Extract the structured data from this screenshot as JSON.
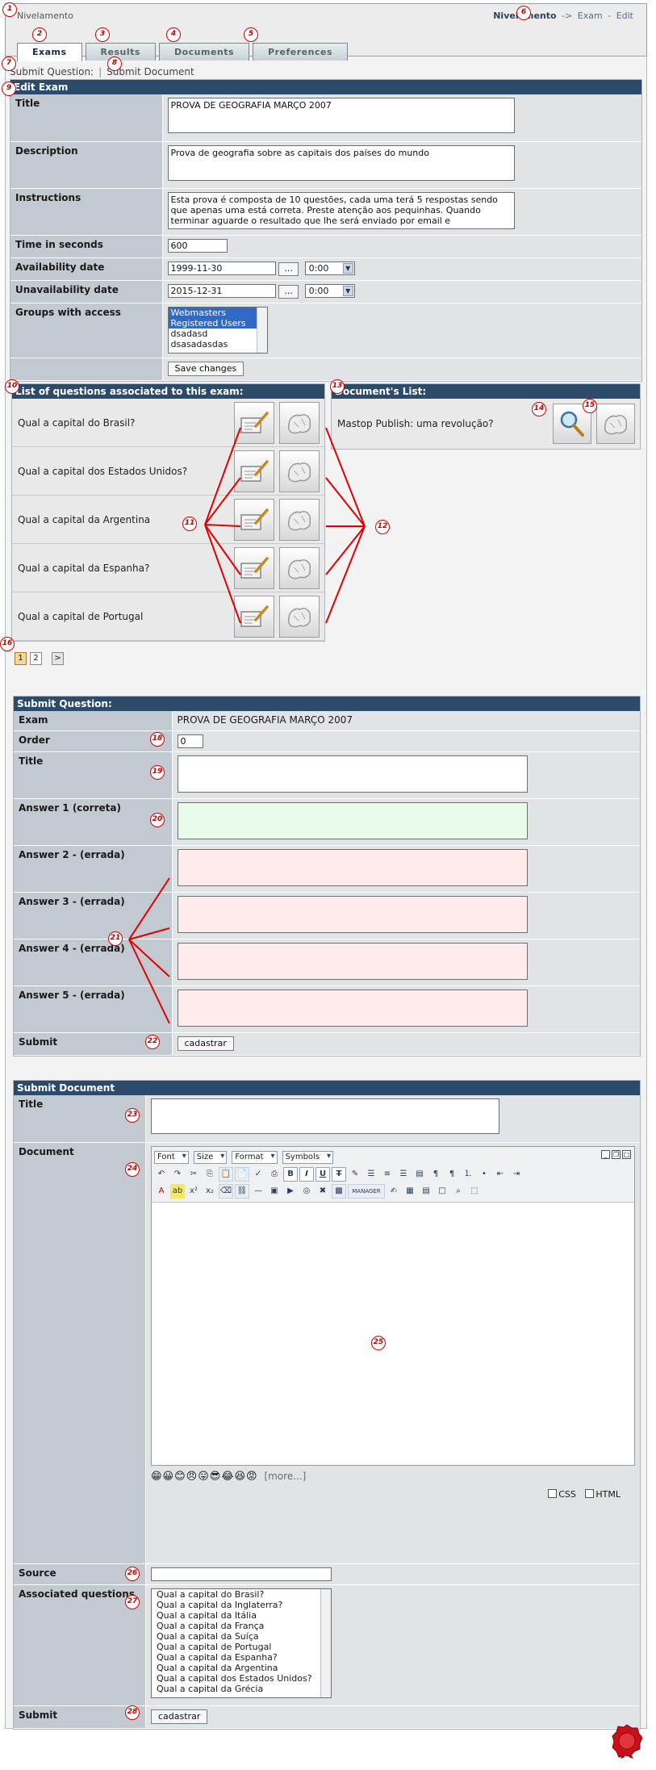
{
  "header": {
    "site_title": "Nivelamento",
    "breadcrumb_root": "Nivelamento",
    "breadcrumb_arrow": "->",
    "breadcrumb_exam": "Exam",
    "breadcrumb_sep": "-",
    "breadcrumb_edit": "Edit"
  },
  "tabs": [
    {
      "label": "Exams"
    },
    {
      "label": "Results"
    },
    {
      "label": "Documents"
    },
    {
      "label": "Preferences"
    }
  ],
  "subnav": {
    "submit_question": "Submit Question:",
    "separator": "|",
    "submit_document": "Submit Document"
  },
  "edit_exam": {
    "heading": "Edit Exam",
    "title_label": "Title",
    "title_value": "PROVA DE GEOGRAFIA MARÇO 2007",
    "description_label": "Description",
    "description_value": "Prova de geografia sobre as capitais dos países do mundo",
    "instructions_label": "Instructions",
    "instructions_value": "Esta prova é composta de 10 questões, cada uma terá 5 respostas sendo que apenas uma está correta. Preste atenção aos pequinhas. Quando terminar aguarde o resultado que lhe será enviado por email e",
    "time_label": "Time in seconds",
    "time_value": "600",
    "availability_label": "Availability date",
    "availability_date": "1999-11-30",
    "availability_time": "0:00",
    "unavailability_label": "Unavailability date",
    "unavailability_date": "2015-12-31",
    "unavailability_time": "0:00",
    "date_button": "...",
    "groups_label": "Groups with access",
    "groups": [
      "Webmasters",
      "Registered Users",
      "dsadasd",
      "dsasadasdas"
    ],
    "save_button": "Save changes"
  },
  "questions": {
    "heading": "List of questions associated to this exam:",
    "items": [
      "Qual a capital do Brasil?",
      "Qual a capital dos Estados Unidos?",
      "Qual a capital da Argentina",
      "Qual a capital da Espanha?",
      "Qual a capital de Portugal"
    ],
    "pages": [
      "1",
      "2"
    ],
    "next_page": ">"
  },
  "documents": {
    "heading": "Document's List:",
    "items": [
      "Mastop Publish: uma revolução?"
    ]
  },
  "submit_question": {
    "heading": "Submit Question:",
    "exam_label": "Exam",
    "exam_value": "PROVA DE GEOGRAFIA MARÇO 2007",
    "order_label": "Order",
    "order_value": "0",
    "title_label": "Title",
    "answer1_label": "Answer 1 (correta)",
    "answer2_label": "Answer 2 - (errada)",
    "answer3_label": "Answer 3 - (errada)",
    "answer4_label": "Answer 4 - (errada)",
    "answer5_label": "Answer 5 - (errada)",
    "submit_label": "Submit",
    "submit_button": "cadastrar"
  },
  "submit_document": {
    "heading": "Submit Document",
    "title_label": "Title",
    "document_label": "Document",
    "editor": {
      "font": "Font",
      "size": "Size",
      "format": "Format",
      "symbols": "Symbols",
      "manager": "MANAGER",
      "more_link": "[more...]",
      "css_label": "CSS",
      "html_label": "HTML"
    },
    "source_label": "Source",
    "assoc_label": "Associated questions",
    "assoc_questions": [
      "Qual a capital do Brasil?",
      "Qual a capital da Inglaterra?",
      "Qual a capital da Itália",
      "Qual a capital da França",
      "Qual a capital da Suíça",
      "Qual a capital de Portugal",
      "Qual a capital da Espanha?",
      "Qual a capital da Argentina",
      "Qual a capital dos Estados Unidos?",
      "Qual a capital da Grécia"
    ],
    "submit_label": "Submit",
    "submit_button": "cadastrar"
  },
  "callouts": [
    "1",
    "2",
    "3",
    "4",
    "5",
    "6",
    "7",
    "8",
    "9",
    "10",
    "11",
    "12",
    "13",
    "14",
    "15",
    "16",
    "18",
    "19",
    "20",
    "21",
    "22",
    "23",
    "24",
    "25",
    "26",
    "27",
    "28"
  ],
  "colors": {
    "header_bar": "#2c4b6b",
    "label_bg": "#c3c9d0",
    "correct_answer_bg": "#e9fbe9",
    "wrong_answer_bg": "#fdeceb",
    "callout": "#d20000"
  }
}
